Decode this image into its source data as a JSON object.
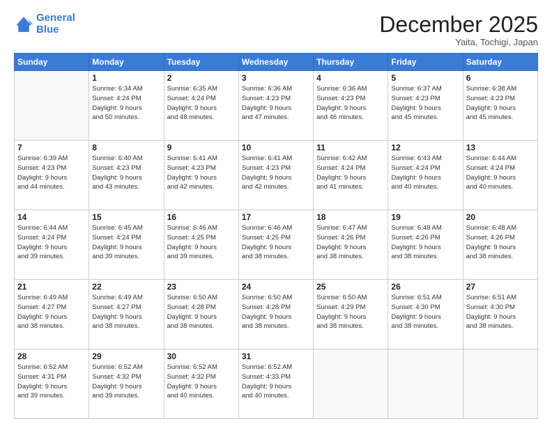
{
  "header": {
    "logo_line1": "General",
    "logo_line2": "Blue",
    "month": "December 2025",
    "location": "Yaita, Tochigi, Japan"
  },
  "weekdays": [
    "Sunday",
    "Monday",
    "Tuesday",
    "Wednesday",
    "Thursday",
    "Friday",
    "Saturday"
  ],
  "weeks": [
    [
      {
        "day": "",
        "info": ""
      },
      {
        "day": "1",
        "info": "Sunrise: 6:34 AM\nSunset: 4:24 PM\nDaylight: 9 hours\nand 50 minutes."
      },
      {
        "day": "2",
        "info": "Sunrise: 6:35 AM\nSunset: 4:24 PM\nDaylight: 9 hours\nand 48 minutes."
      },
      {
        "day": "3",
        "info": "Sunrise: 6:36 AM\nSunset: 4:23 PM\nDaylight: 9 hours\nand 47 minutes."
      },
      {
        "day": "4",
        "info": "Sunrise: 6:36 AM\nSunset: 4:23 PM\nDaylight: 9 hours\nand 46 minutes."
      },
      {
        "day": "5",
        "info": "Sunrise: 6:37 AM\nSunset: 4:23 PM\nDaylight: 9 hours\nand 45 minutes."
      },
      {
        "day": "6",
        "info": "Sunrise: 6:38 AM\nSunset: 4:23 PM\nDaylight: 9 hours\nand 45 minutes."
      }
    ],
    [
      {
        "day": "7",
        "info": "Sunrise: 6:39 AM\nSunset: 4:23 PM\nDaylight: 9 hours\nand 44 minutes."
      },
      {
        "day": "8",
        "info": "Sunrise: 6:40 AM\nSunset: 4:23 PM\nDaylight: 9 hours\nand 43 minutes."
      },
      {
        "day": "9",
        "info": "Sunrise: 6:41 AM\nSunset: 4:23 PM\nDaylight: 9 hours\nand 42 minutes."
      },
      {
        "day": "10",
        "info": "Sunrise: 6:41 AM\nSunset: 4:23 PM\nDaylight: 9 hours\nand 42 minutes."
      },
      {
        "day": "11",
        "info": "Sunrise: 6:42 AM\nSunset: 4:24 PM\nDaylight: 9 hours\nand 41 minutes."
      },
      {
        "day": "12",
        "info": "Sunrise: 6:43 AM\nSunset: 4:24 PM\nDaylight: 9 hours\nand 40 minutes."
      },
      {
        "day": "13",
        "info": "Sunrise: 6:44 AM\nSunset: 4:24 PM\nDaylight: 9 hours\nand 40 minutes."
      }
    ],
    [
      {
        "day": "14",
        "info": "Sunrise: 6:44 AM\nSunset: 4:24 PM\nDaylight: 9 hours\nand 39 minutes."
      },
      {
        "day": "15",
        "info": "Sunrise: 6:45 AM\nSunset: 4:24 PM\nDaylight: 9 hours\nand 39 minutes."
      },
      {
        "day": "16",
        "info": "Sunrise: 6:46 AM\nSunset: 4:25 PM\nDaylight: 9 hours\nand 39 minutes."
      },
      {
        "day": "17",
        "info": "Sunrise: 6:46 AM\nSunset: 4:25 PM\nDaylight: 9 hours\nand 38 minutes."
      },
      {
        "day": "18",
        "info": "Sunrise: 6:47 AM\nSunset: 4:26 PM\nDaylight: 9 hours\nand 38 minutes."
      },
      {
        "day": "19",
        "info": "Sunrise: 6:48 AM\nSunset: 4:26 PM\nDaylight: 9 hours\nand 38 minutes."
      },
      {
        "day": "20",
        "info": "Sunrise: 6:48 AM\nSunset: 4:26 PM\nDaylight: 9 hours\nand 38 minutes."
      }
    ],
    [
      {
        "day": "21",
        "info": "Sunrise: 6:49 AM\nSunset: 4:27 PM\nDaylight: 9 hours\nand 38 minutes."
      },
      {
        "day": "22",
        "info": "Sunrise: 6:49 AM\nSunset: 4:27 PM\nDaylight: 9 hours\nand 38 minutes."
      },
      {
        "day": "23",
        "info": "Sunrise: 6:50 AM\nSunset: 4:28 PM\nDaylight: 9 hours\nand 38 minutes."
      },
      {
        "day": "24",
        "info": "Sunrise: 6:50 AM\nSunset: 4:28 PM\nDaylight: 9 hours\nand 38 minutes."
      },
      {
        "day": "25",
        "info": "Sunrise: 6:50 AM\nSunset: 4:29 PM\nDaylight: 9 hours\nand 38 minutes."
      },
      {
        "day": "26",
        "info": "Sunrise: 6:51 AM\nSunset: 4:30 PM\nDaylight: 9 hours\nand 38 minutes."
      },
      {
        "day": "27",
        "info": "Sunrise: 6:51 AM\nSunset: 4:30 PM\nDaylight: 9 hours\nand 38 minutes."
      }
    ],
    [
      {
        "day": "28",
        "info": "Sunrise: 6:52 AM\nSunset: 4:31 PM\nDaylight: 9 hours\nand 39 minutes."
      },
      {
        "day": "29",
        "info": "Sunrise: 6:52 AM\nSunset: 4:32 PM\nDaylight: 9 hours\nand 39 minutes."
      },
      {
        "day": "30",
        "info": "Sunrise: 6:52 AM\nSunset: 4:32 PM\nDaylight: 9 hours\nand 40 minutes."
      },
      {
        "day": "31",
        "info": "Sunrise: 6:52 AM\nSunset: 4:33 PM\nDaylight: 9 hours\nand 40 minutes."
      },
      {
        "day": "",
        "info": ""
      },
      {
        "day": "",
        "info": ""
      },
      {
        "day": "",
        "info": ""
      }
    ]
  ]
}
